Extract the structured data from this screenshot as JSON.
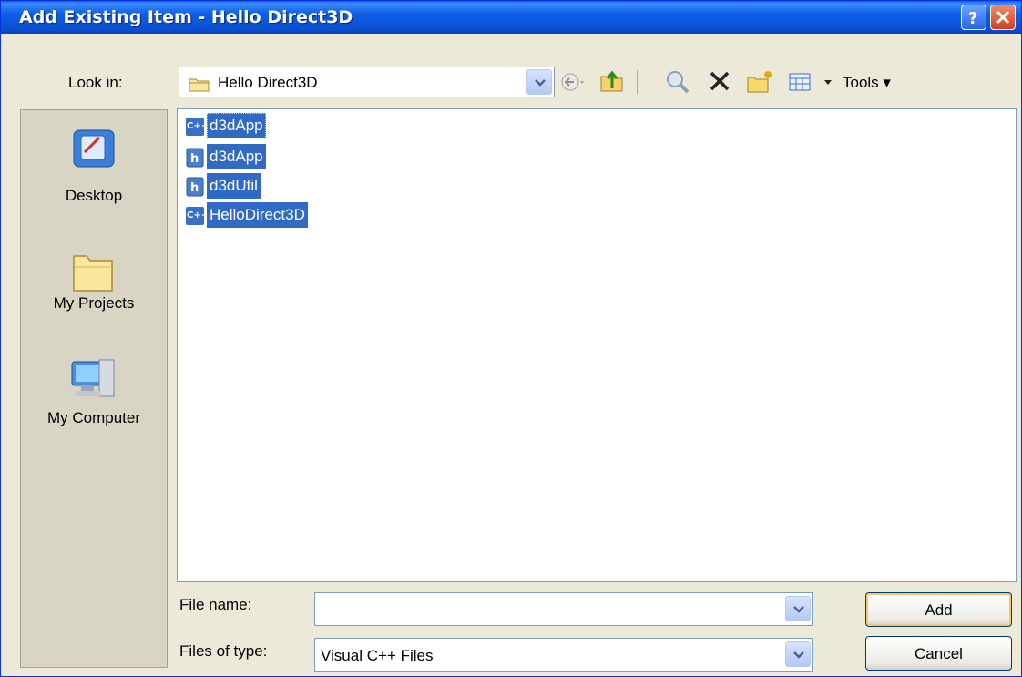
{
  "window": {
    "title": "Add Existing Item - Hello Direct3D"
  },
  "look_in": {
    "label": "Look in:",
    "value": "Hello Direct3D"
  },
  "toolbar": {
    "back_icon": "back-arrow-icon",
    "up_icon": "up-one-level-icon",
    "search_icon": "search-web-icon",
    "delete_icon": "delete-icon",
    "new_folder_icon": "new-folder-icon",
    "views_icon": "views-menu-icon",
    "tools_label": "Tools"
  },
  "places": [
    {
      "label": "Desktop",
      "icon": "desktop-icon"
    },
    {
      "label": "My Projects",
      "icon": "folder-icon"
    },
    {
      "label": "My Computer",
      "icon": "my-computer-icon"
    }
  ],
  "files": [
    {
      "name": "d3dApp",
      "type": "cpp",
      "selected": true
    },
    {
      "name": "d3dApp",
      "type": "h",
      "selected": true
    },
    {
      "name": "d3dUtil",
      "type": "h",
      "selected": true
    },
    {
      "name": "HelloDirect3D",
      "type": "cpp",
      "selected": true
    }
  ],
  "file_name": {
    "label": "File name:",
    "value": ""
  },
  "files_of_type": {
    "label": "Files of type:",
    "value": "Visual C++ Files"
  },
  "buttons": {
    "add": "Add",
    "cancel": "Cancel"
  },
  "colors": {
    "titlebar": "#0a5fe0",
    "selection": "#316ac5",
    "dialog_bg": "#ece9d8"
  }
}
